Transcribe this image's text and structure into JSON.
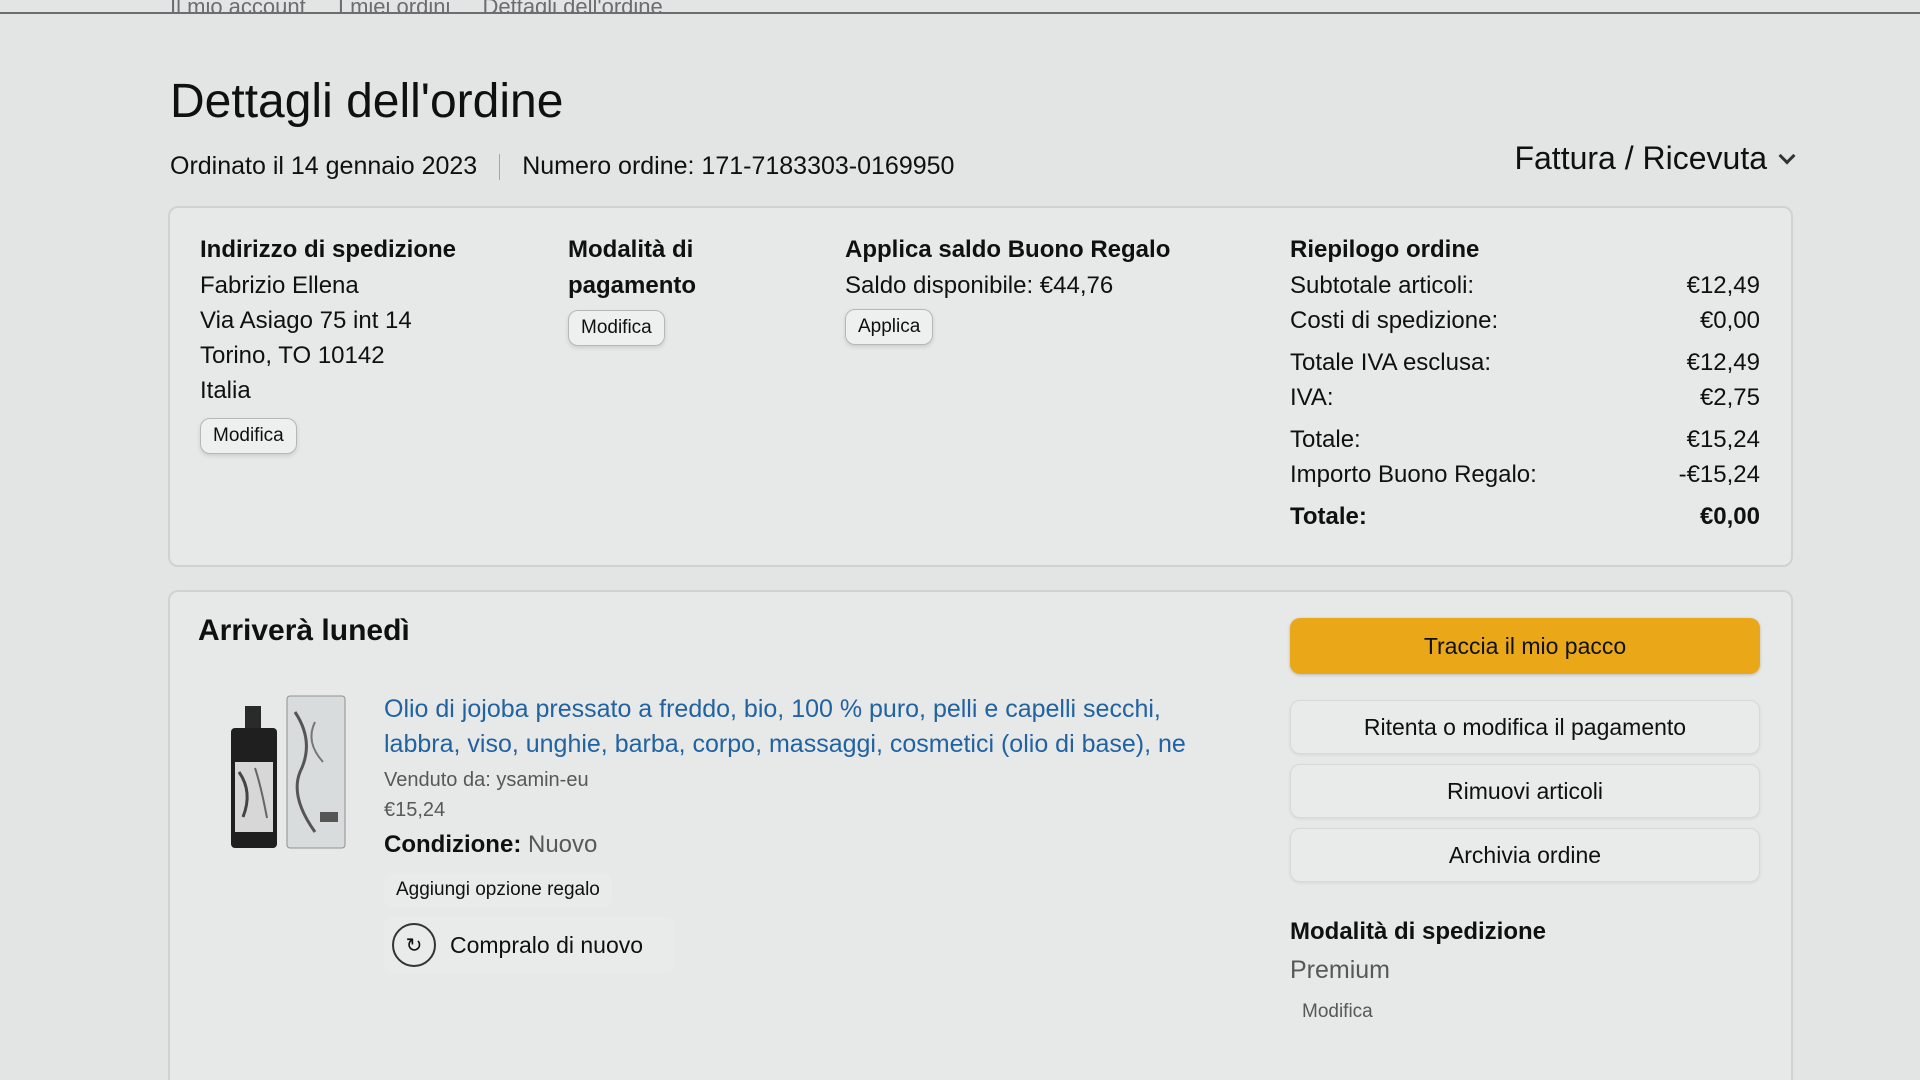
{
  "breadcrumb": [
    "Il mio account",
    "I miei ordini",
    "Dettagli dell'ordine"
  ],
  "title": "Dettagli dell'ordine",
  "order": {
    "date_text": "Ordinato il 14 gennaio 2023",
    "number_text": "Numero ordine: 171-7183303-0169950"
  },
  "invoice_label": "Fattura / Ricevuta",
  "shipping": {
    "title": "Indirizzo di spedizione",
    "lines": [
      "Fabrizio Ellena",
      "Via Asiago 75 int 14",
      "Torino, TO 10142",
      "Italia"
    ],
    "edit_label": "Modifica"
  },
  "payment": {
    "title_line1": "Modalità di",
    "title_line2": "pagamento",
    "edit_label": "Modifica"
  },
  "gift_card": {
    "title": "Applica saldo Buono Regalo",
    "balance": "Saldo disponibile: €44,76",
    "apply_label": "Applica"
  },
  "summary": {
    "title": "Riepilogo ordine",
    "rows": [
      {
        "label": "Subtotale articoli:",
        "value": "€12,49"
      },
      {
        "label": "Costi di spedizione:",
        "value": "€0,00"
      },
      {
        "label": "Totale IVA esclusa:",
        "value": "€12,49"
      },
      {
        "label": "IVA:",
        "value": "€2,75"
      },
      {
        "label": "Totale:",
        "value": "€15,24"
      },
      {
        "label": "Importo Buono Regalo:",
        "value": "-€15,24"
      },
      {
        "label": "Totale:",
        "value": "€0,00"
      }
    ]
  },
  "delivery": {
    "title": "Arriverà lunedì",
    "product_title": "Olio di jojoba pressato a freddo, bio, 100 % puro, pelli e capelli secchi, labbra, viso, unghie, barba, corpo, massaggi, cosmetici (olio di base), ne",
    "sold_by": "Venduto da: ysamin-eu",
    "price": "€15,24",
    "condition_label": "Condizione:",
    "condition_value": "Nuovo",
    "gift_option_label": "Aggiungi opzione regalo",
    "buy_again_label": "Compralo di nuovo"
  },
  "actions": {
    "track": "Traccia il mio pacco",
    "retry_payment": "Ritenta o modifica il pagamento",
    "remove_items": "Rimuovi articoli",
    "archive": "Archivia ordine"
  },
  "shipping_method": {
    "title": "Modalità di spedizione",
    "value": "Premium",
    "edit_label": "Modifica"
  },
  "colors": {
    "primary_button": "#eaa818",
    "link": "#2162a1",
    "background": "#e3e5e5"
  }
}
